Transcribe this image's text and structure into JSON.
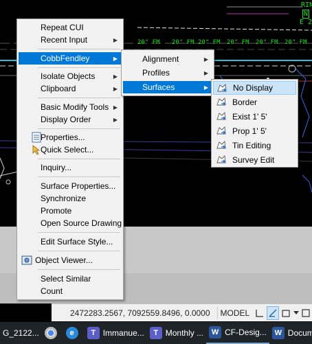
{
  "cad": {
    "labels": [
      "20\" FM",
      "20\" FM",
      "20\" FM",
      "20\" FM",
      "20\" FM",
      "20\" FM"
    ],
    "corner_text": [
      "RIN",
      "N",
      "E 2"
    ]
  },
  "context_menu": {
    "items": [
      {
        "label": "Repeat CUI",
        "submenu": false
      },
      {
        "label": "Recent Input",
        "submenu": true
      },
      {
        "label": "CobbFendley",
        "submenu": true,
        "highlighted": true
      },
      {
        "label": "Isolate Objects",
        "submenu": true
      },
      {
        "label": "Clipboard",
        "submenu": true
      },
      {
        "label": "Basic Modify Tools",
        "submenu": true
      },
      {
        "label": "Display Order",
        "submenu": true
      },
      {
        "label": "Properties...",
        "submenu": false,
        "icon": "properties-icon"
      },
      {
        "label": "Quick Select...",
        "submenu": false,
        "icon": "quick-select-icon"
      },
      {
        "label": "Inquiry...",
        "submenu": false
      },
      {
        "label": "Surface Properties...",
        "submenu": false
      },
      {
        "label": "Synchronize",
        "submenu": false
      },
      {
        "label": "Promote",
        "submenu": false
      },
      {
        "label": "Open Source Drawing",
        "submenu": false
      },
      {
        "label": "Edit Surface Style...",
        "submenu": false
      },
      {
        "label": "Object Viewer...",
        "submenu": false,
        "icon": "object-viewer-icon"
      },
      {
        "label": "Select Similar",
        "submenu": false
      },
      {
        "label": "Count",
        "submenu": false
      }
    ]
  },
  "cobbfendley_submenu": {
    "items": [
      {
        "label": "Alignment",
        "submenu": true
      },
      {
        "label": "Profiles",
        "submenu": true
      },
      {
        "label": "Surfaces",
        "submenu": true,
        "highlighted": true
      }
    ]
  },
  "surfaces_submenu": {
    "items": [
      {
        "label": "No Display",
        "icon": "surface-style-icon",
        "highlighted": true
      },
      {
        "label": "Border",
        "icon": "surface-style-icon"
      },
      {
        "label": "Exist 1'  5'",
        "icon": "surface-style-icon"
      },
      {
        "label": "Prop 1'  5'",
        "icon": "surface-style-icon"
      },
      {
        "label": "Tin Editing",
        "icon": "surface-style-icon"
      },
      {
        "label": "Survey Edit",
        "icon": "surface-style-icon"
      }
    ]
  },
  "statusbar": {
    "coordinates": "2472283.2567, 7092559.8496, 0.0000",
    "model_label": "MODEL"
  },
  "taskbar": {
    "items": [
      {
        "label": "G_2122...",
        "icon": "autocad-icon"
      },
      {
        "label": "",
        "icon": "chrome-icon"
      },
      {
        "label": "",
        "icon": "edge-icon"
      },
      {
        "label": "Immanue...",
        "icon": "teams-icon"
      },
      {
        "label": "Monthly ...",
        "icon": "teams-icon"
      },
      {
        "label": "CF-Desig...",
        "icon": "word-icon"
      },
      {
        "label": "Docume...",
        "icon": "word-icon"
      }
    ]
  },
  "colors": {
    "menu_highlight": "#0078d7",
    "submenu_highlight": "#cce4f7",
    "cad_background": "#000000",
    "taskbar": "#1f2429"
  }
}
